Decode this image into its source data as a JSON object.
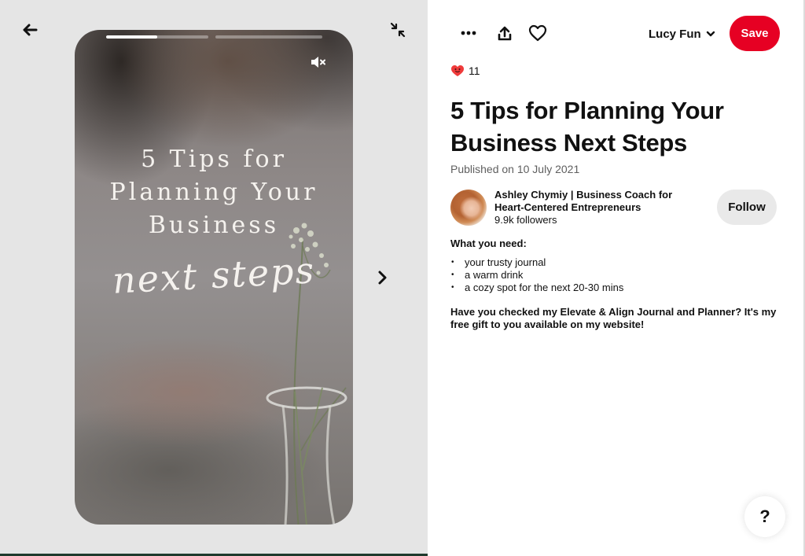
{
  "viewer": {
    "back_icon": "arrow-left-icon",
    "minimize_icon": "minimize-arrows-icon",
    "next_icon": "chevron-right-icon",
    "mute_icon": "speaker-muted-icon",
    "story_pages": [
      {
        "progress": 0.5
      },
      {
        "progress": 0
      }
    ],
    "overlay_text": {
      "line1": "5 Tips for",
      "line2": "Planning Your",
      "line3": "Business",
      "line4": "next steps"
    }
  },
  "toolbar": {
    "more_icon": "ellipsis-icon",
    "share_icon": "share-upload-icon",
    "like_icon": "heart-outline-icon",
    "board_name": "Lucy Fun",
    "save_label": "Save",
    "accent_color": "#e60023"
  },
  "pin": {
    "reaction_icon": "heart-smile-emoji-icon",
    "reaction_count": "11",
    "title": "5 Tips for Planning Your Business Next Steps",
    "published": "Published on 10 July 2021",
    "creator": {
      "name": "Ashley Chymiy | Business Coach for Heart-Centered Entrepreneurs",
      "followers": "9.9k followers",
      "follow_label": "Follow"
    },
    "description": {
      "heading": "What you need:",
      "items": [
        "your trusty journal",
        "a warm drink",
        "a cozy spot for the next 20-30 mins"
      ],
      "paragraph": "Have you checked my Elevate & Align Journal and Planner? It's my free gift to you available on my website!"
    }
  },
  "help": {
    "label": "?"
  }
}
